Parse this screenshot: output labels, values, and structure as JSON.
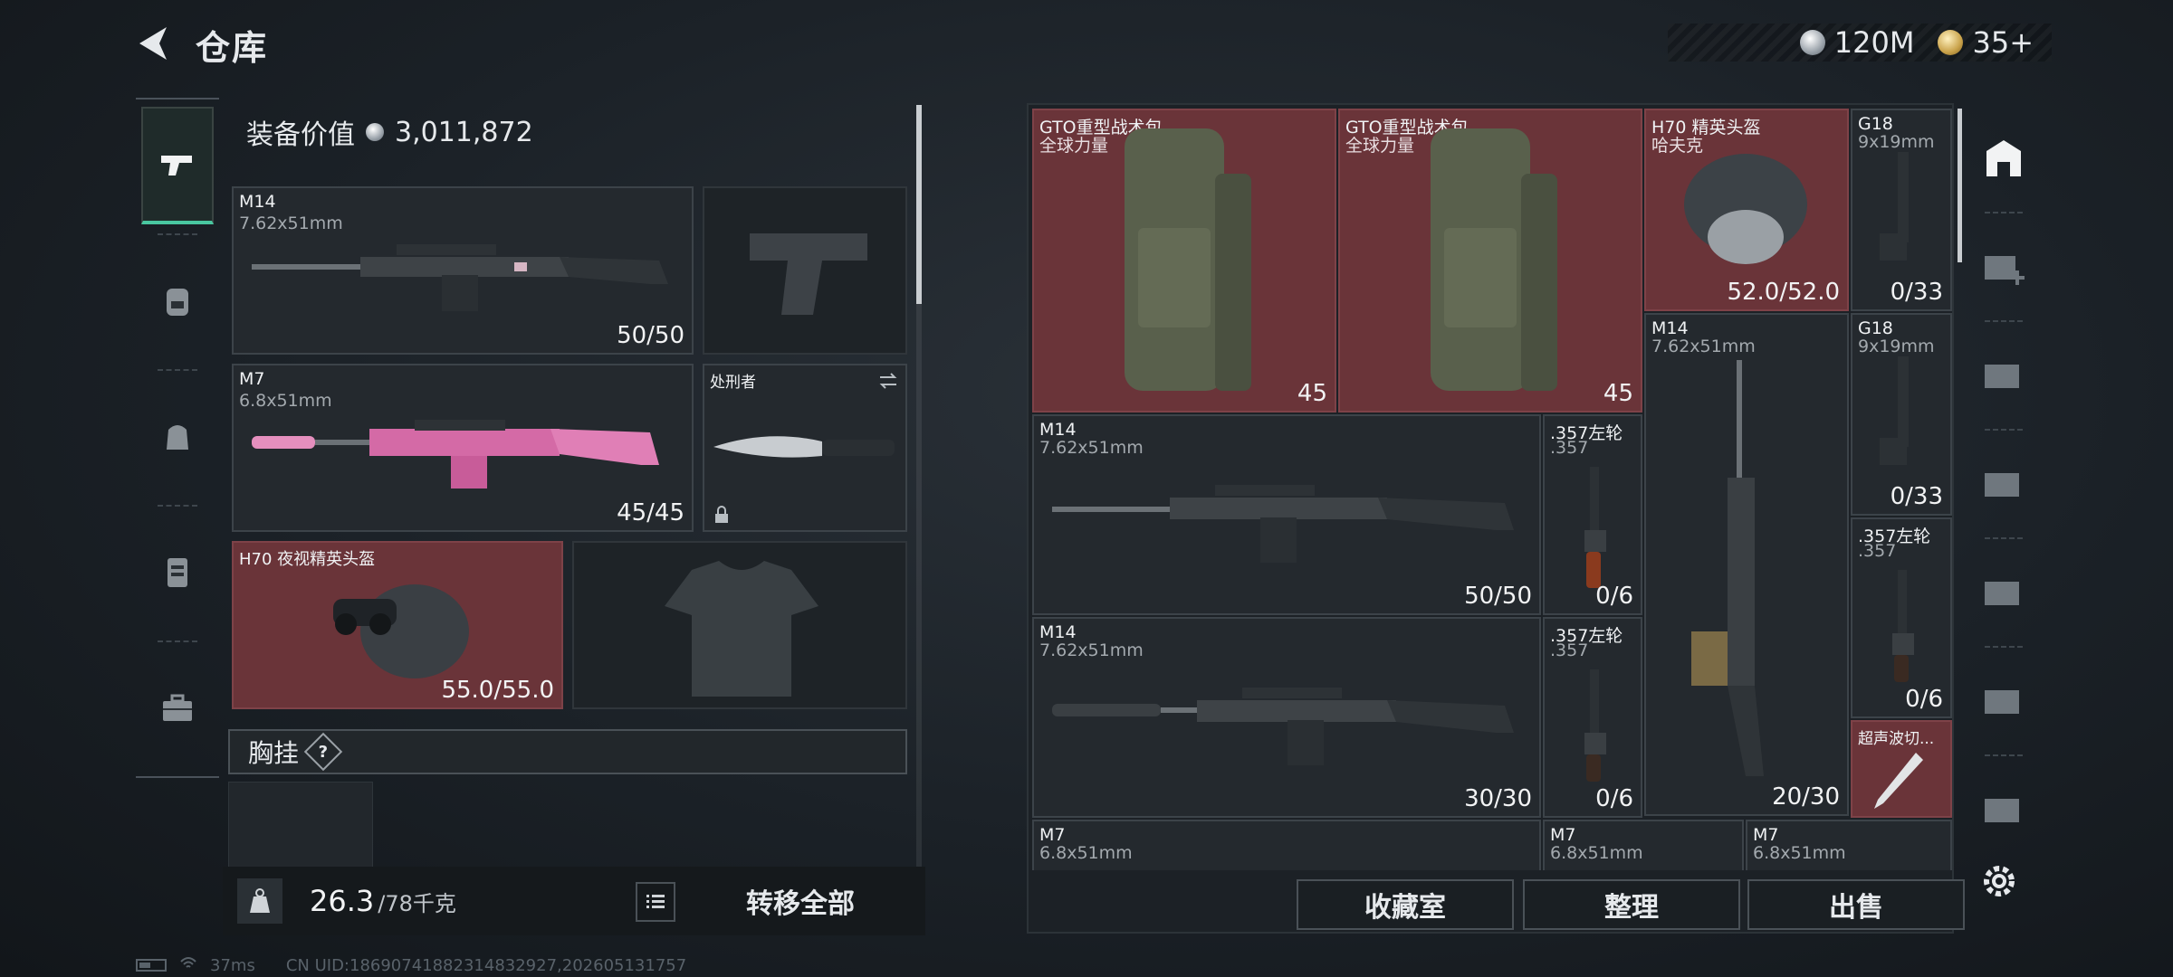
{
  "header": {
    "title": "仓库",
    "currency": [
      {
        "icon": "silver-coin-icon",
        "value": "120M"
      },
      {
        "icon": "gold-coin-icon",
        "value": "35+"
      }
    ]
  },
  "equipment": {
    "value_label": "装备价值",
    "value": "3,011,872",
    "slots": {
      "primary1": {
        "name": "M14",
        "caliber": "7.62x51mm",
        "ammo": "50/50"
      },
      "primary2": {
        "name": "M7",
        "caliber": "6.8x51mm",
        "ammo": "45/45"
      },
      "melee": {
        "name": "处刑者"
      },
      "helmet": {
        "name": "H70 夜视精英头盔",
        "durability": "55.0/55.0"
      }
    },
    "chest_rig": {
      "label": "胸挂",
      "help": "?"
    }
  },
  "weight": {
    "current": "26.3",
    "max": "/78千克"
  },
  "actions": {
    "transfer_all": "转移全部"
  },
  "stash": {
    "items": [
      {
        "name": "GTO重型战术包",
        "sub": "全球力量",
        "count": "45"
      },
      {
        "name": "GTO重型战术包",
        "sub": "全球力量",
        "count": "45"
      },
      {
        "name": "H70 精英头盔",
        "sub": "哈夫克",
        "count": "52.0/52.0"
      },
      {
        "name": "G18",
        "sub": "9x19mm",
        "count": "0/33"
      },
      {
        "name": "M14",
        "sub": "7.62x51mm",
        "count": "20/30"
      },
      {
        "name": "G18",
        "sub": "9x19mm",
        "count": "0/33"
      },
      {
        "name": "M14",
        "sub": "7.62x51mm",
        "count": "50/50"
      },
      {
        "name": ".357左轮",
        "sub": ".357",
        "count": "0/6"
      },
      {
        "name": ".357左轮",
        "sub": ".357",
        "count": "0/6"
      },
      {
        "name": "M14",
        "sub": "7.62x51mm",
        "count": "30/30"
      },
      {
        "name": ".357左轮",
        "sub": ".357",
        "count": "0/6"
      },
      {
        "name": "超声波切...",
        "sub": "",
        "count": ""
      },
      {
        "name": "M7",
        "sub": "6.8x51mm",
        "count": ""
      },
      {
        "name": "M7",
        "sub": "6.8x51mm",
        "count": ""
      },
      {
        "name": "M7",
        "sub": "6.8x51mm",
        "count": ""
      }
    ],
    "buttons": {
      "collection": "收藏室",
      "organize": "整理",
      "sell": "出售"
    }
  },
  "status": {
    "ping": "37ms",
    "uid": "CN UID:18690741882314832927,202605131757"
  }
}
